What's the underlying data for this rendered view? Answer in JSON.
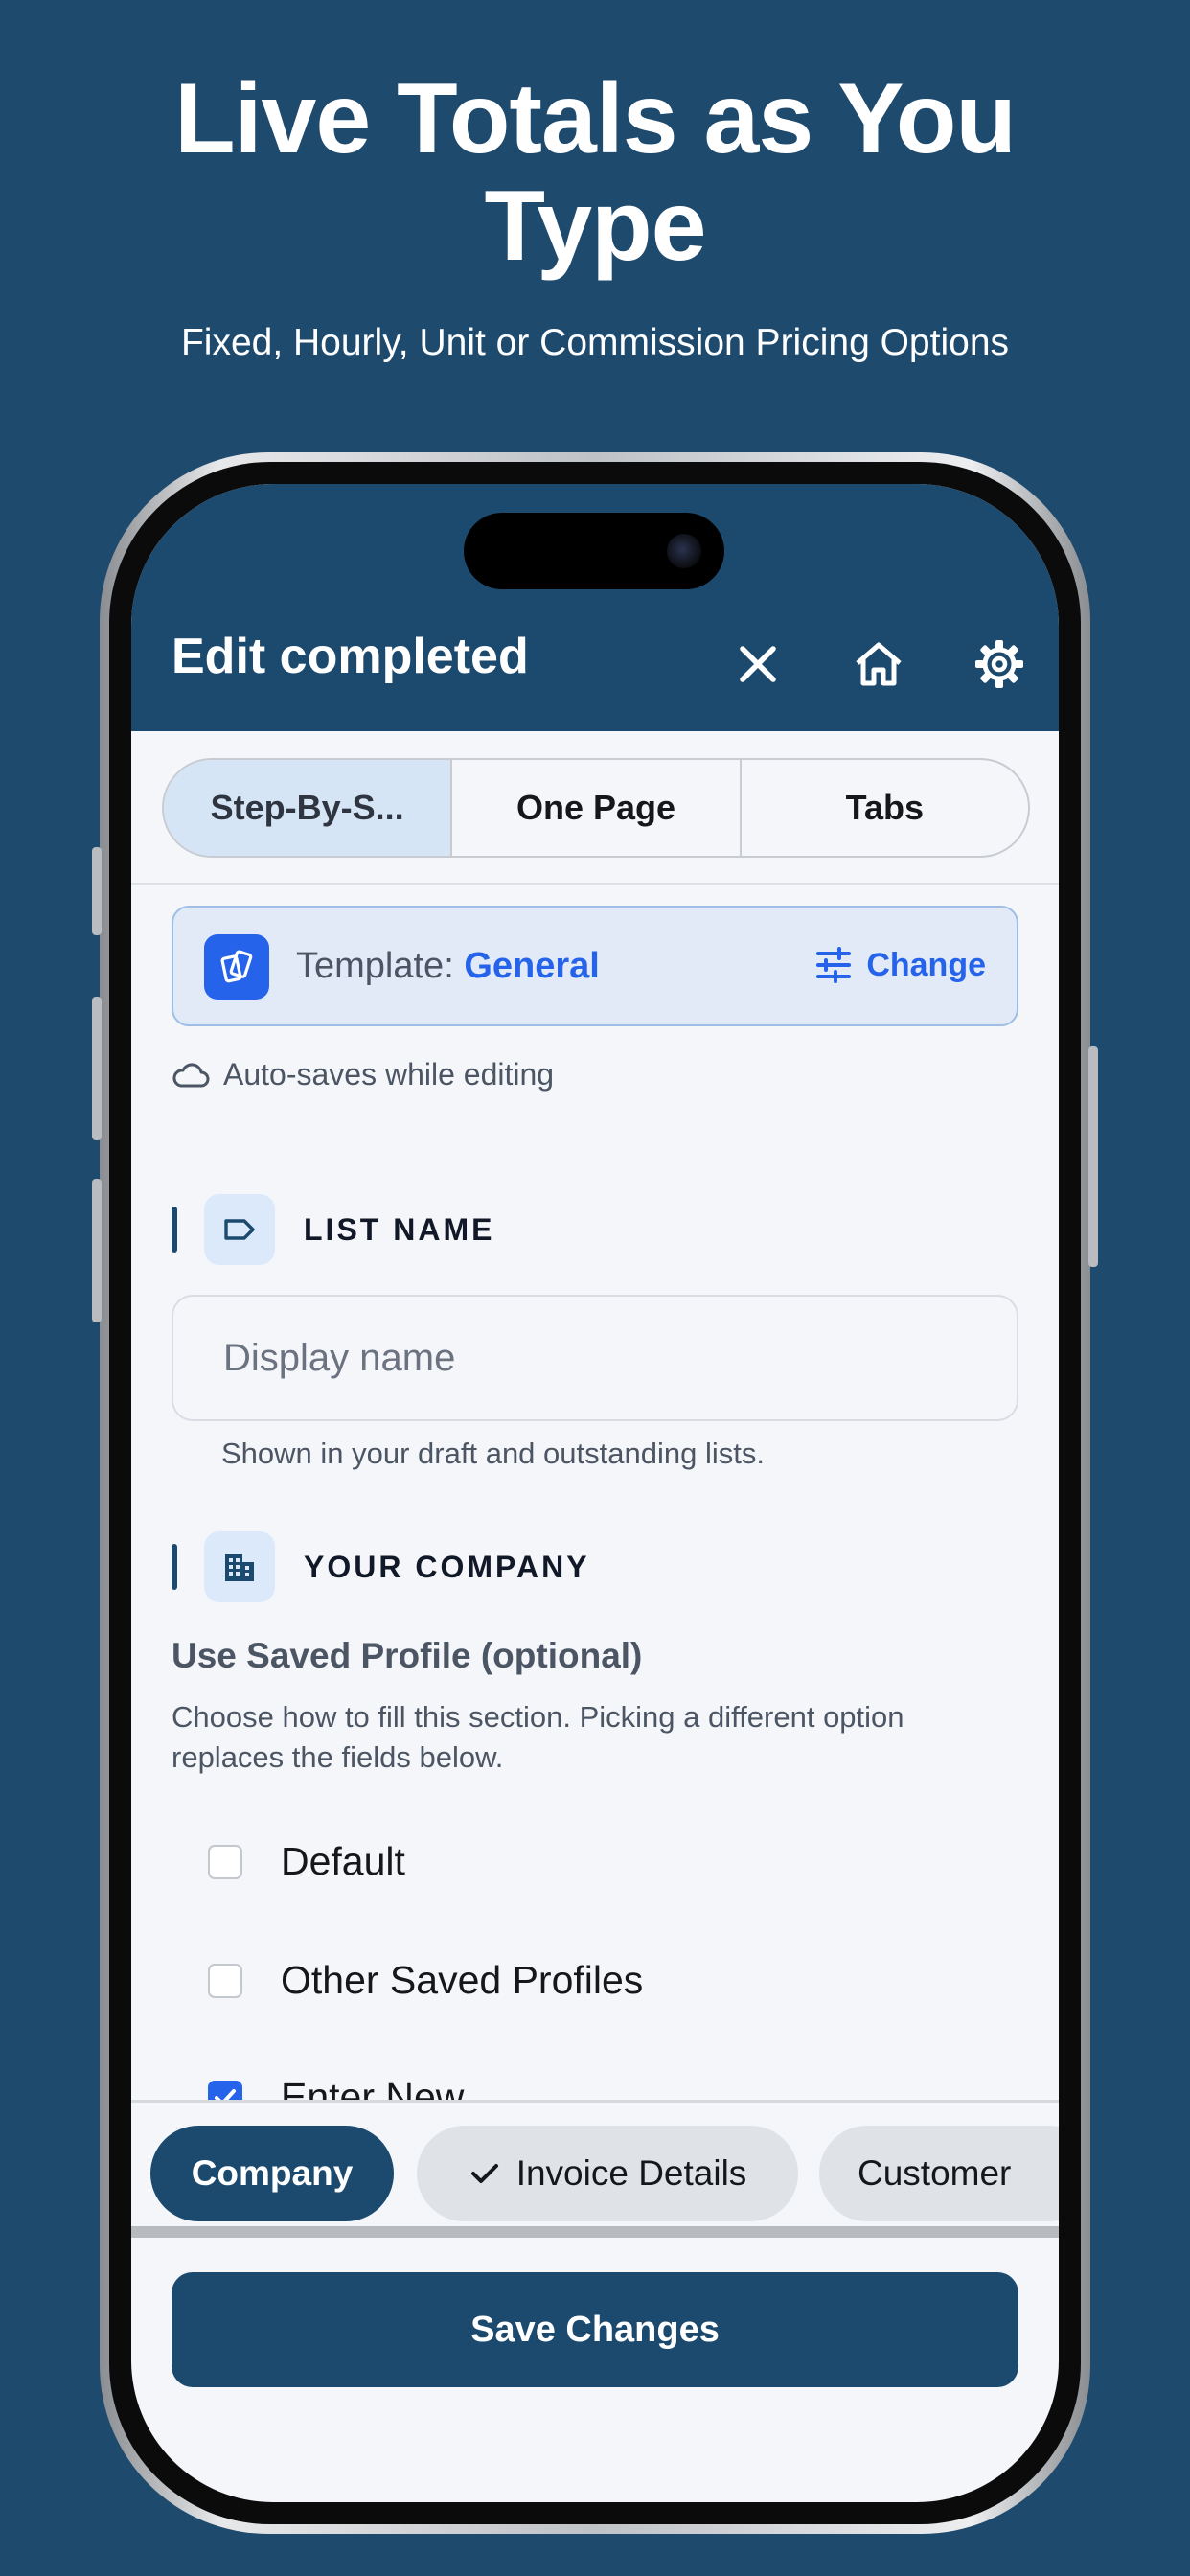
{
  "marketing": {
    "headline_line1": "Live Totals as You",
    "headline_line2": "Type",
    "subheadline": "Fixed, Hourly, Unit or Commission Pricing Options"
  },
  "appbar": {
    "title": "Edit completed",
    "icons": [
      "close-icon",
      "home-icon",
      "gear-icon"
    ]
  },
  "segments": [
    {
      "label": "Step-By-S...",
      "active": true
    },
    {
      "label": "One Page",
      "active": false
    },
    {
      "label": "Tabs",
      "active": false
    }
  ],
  "template": {
    "prefix": "Template:",
    "name": "General",
    "change_label": "Change"
  },
  "autosave": {
    "text": "Auto-saves while editing"
  },
  "list_name": {
    "heading": "LIST NAME",
    "placeholder": "Display name",
    "value": "",
    "helper": "Shown in your draft and outstanding lists."
  },
  "company": {
    "heading": "YOUR COMPANY",
    "profile_title": "Use Saved Profile (optional)",
    "profile_desc": "Choose how to fill this section. Picking a different option replaces the fields below.",
    "options": [
      {
        "label": "Default",
        "checked": false
      },
      {
        "label": "Other Saved Profiles",
        "checked": false
      },
      {
        "label": "Enter New",
        "checked": true
      }
    ]
  },
  "steps": [
    {
      "label": "Company",
      "active": true,
      "done": false
    },
    {
      "label": "Invoice Details",
      "active": false,
      "done": true
    },
    {
      "label": "Customer",
      "active": false,
      "done": false
    }
  ],
  "save_button": {
    "label": "Save Changes"
  },
  "colors": {
    "background": "#1e4a6e",
    "appbar": "#1c4a6e",
    "accent": "#2563eb",
    "surface": "#f4f6fa"
  }
}
